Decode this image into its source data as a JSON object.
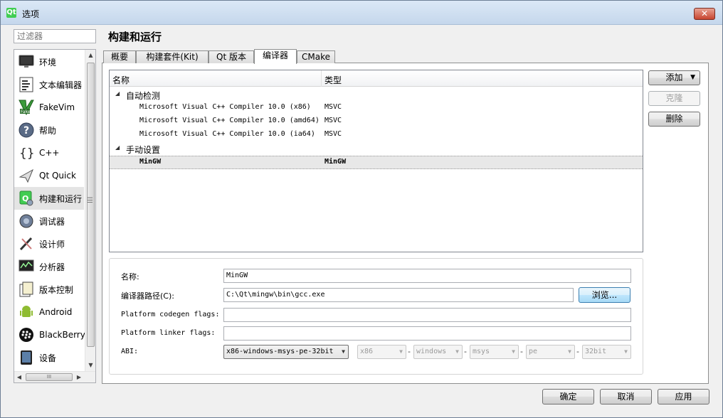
{
  "window": {
    "title": "选项",
    "close_label": "✕",
    "app_icon_letter": "Qt"
  },
  "filter": {
    "placeholder": "过滤器"
  },
  "sidebar": {
    "items": [
      {
        "label": "环境",
        "icon": "monitor-icon"
      },
      {
        "label": "文本编辑器",
        "icon": "text-editor-icon"
      },
      {
        "label": "FakeVim",
        "icon": "fakevim-icon"
      },
      {
        "label": "帮助",
        "icon": "help-icon"
      },
      {
        "label": "C++",
        "icon": "cpp-braces-icon"
      },
      {
        "label": "Qt Quick",
        "icon": "qt-quick-icon"
      },
      {
        "label": "构建和运行",
        "icon": "build-run-icon",
        "selected": true
      },
      {
        "label": "调试器",
        "icon": "debugger-icon"
      },
      {
        "label": "设计师",
        "icon": "designer-icon"
      },
      {
        "label": "分析器",
        "icon": "analyzer-icon"
      },
      {
        "label": "版本控制",
        "icon": "version-control-icon"
      },
      {
        "label": "Android",
        "icon": "android-icon"
      },
      {
        "label": "BlackBerry",
        "icon": "blackberry-icon"
      },
      {
        "label": "设备",
        "icon": "device-icon"
      }
    ],
    "hscroll_grip": "III",
    "splitter_grip": "☰"
  },
  "page": {
    "title": "构建和运行"
  },
  "tabs": [
    {
      "label": "概要"
    },
    {
      "label": "构建套件(Kit)"
    },
    {
      "label": "Qt 版本"
    },
    {
      "label": "编译器",
      "active": true
    },
    {
      "label": "CMake"
    }
  ],
  "compiler_tree": {
    "headers": {
      "name": "名称",
      "type": "类型"
    },
    "groups": [
      {
        "label": "自动检测",
        "items": [
          {
            "name": "Microsoft Visual C++ Compiler 10.0 (x86)",
            "type": "MSVC"
          },
          {
            "name": "Microsoft Visual C++ Compiler 10.0 (amd64)",
            "type": "MSVC"
          },
          {
            "name": "Microsoft Visual C++ Compiler 10.0 (ia64)",
            "type": "MSVC"
          }
        ]
      },
      {
        "label": "手动设置",
        "items": [
          {
            "name": "MinGW",
            "type": "MinGW",
            "selected": true
          }
        ]
      }
    ],
    "expander": "◢"
  },
  "side_buttons": {
    "add": "添加",
    "clone": "克隆",
    "remove": "删除"
  },
  "details": {
    "name_label": "名称:",
    "name_value": "MinGW",
    "path_label": "编译器路径(C):",
    "path_value": "C:\\Qt\\mingw\\bin\\gcc.exe",
    "browse_label": "浏览...",
    "codegen_label": "Platform codegen flags:",
    "codegen_value": "",
    "linker_label": "Platform linker flags:",
    "linker_value": "",
    "abi_label": "ABI:",
    "abi_main": "x86-windows-msys-pe-32bit",
    "abi_parts": [
      "x86",
      "windows",
      "msys",
      "pe",
      "32bit"
    ],
    "separator": "-"
  },
  "footer": {
    "ok": "确定",
    "cancel": "取消",
    "apply": "应用"
  },
  "colors": {
    "selection": "#e4e4e4",
    "qt_green": "#41cd52",
    "title_bar": "#c5d7ec"
  }
}
